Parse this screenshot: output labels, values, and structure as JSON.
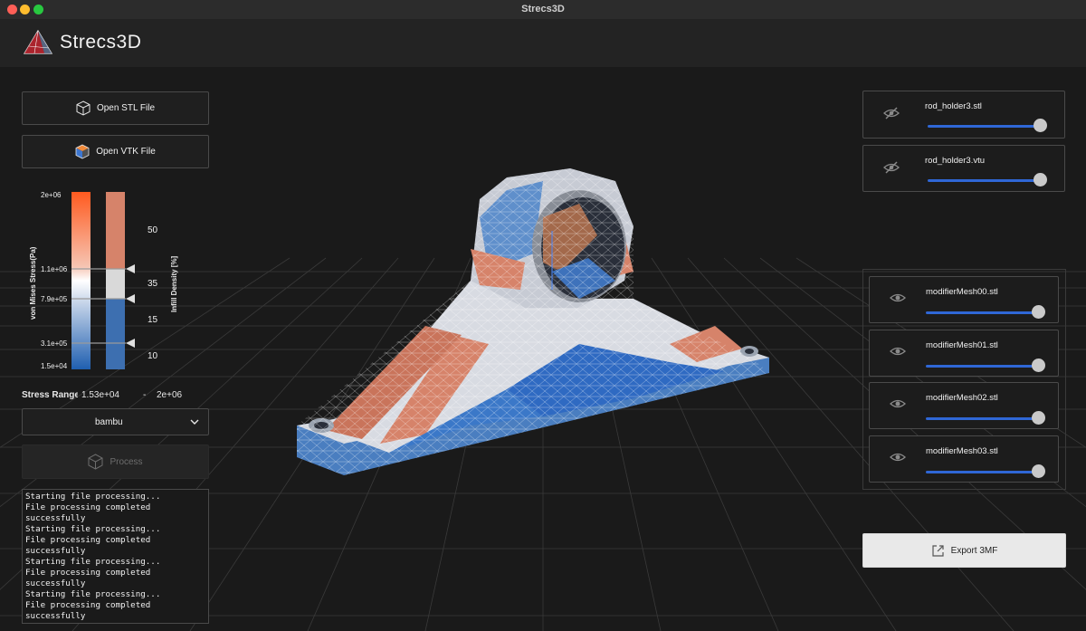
{
  "window": {
    "title": "Strecs3D"
  },
  "header": {
    "brand": "Strecs3D"
  },
  "left_panel": {
    "open_stl_label": "Open STL File",
    "open_vtk_label": "Open VTK File",
    "legend": {
      "stress_axis_label": "von Mises Stress(Pa)",
      "infill_axis_label": "Infill Density [%]",
      "stress_ticks": [
        "2e+06",
        "1.1e+06",
        "7.9e+05",
        "3.1e+05",
        "1.5e+04"
      ],
      "infill_ticks": [
        "50",
        "35",
        "15",
        "10"
      ]
    },
    "stress_range": {
      "label": "Stress Range",
      "min": "1.53e+04",
      "separator": "-",
      "max": "2e+06"
    },
    "preset_select": {
      "value": "bambu"
    },
    "process_label": "Process",
    "log_lines": [
      "Starting file processing...",
      "File processing completed",
      "successfully",
      "Starting file processing...",
      "File processing completed",
      "successfully",
      "Starting file processing...",
      "File processing completed",
      "successfully",
      "Starting file processing...",
      "File processing completed",
      "successfully"
    ]
  },
  "right_panel": {
    "files": [
      {
        "name": "rod_holder3.stl",
        "visible": false,
        "opacity": 1.0
      },
      {
        "name": "rod_holder3.vtu",
        "visible": false,
        "opacity": 1.0
      }
    ],
    "modifiers": [
      {
        "name": "modifierMesh00.stl",
        "visible": true,
        "opacity": 1.0
      },
      {
        "name": "modifierMesh01.stl",
        "visible": true,
        "opacity": 1.0
      },
      {
        "name": "modifierMesh02.stl",
        "visible": true,
        "opacity": 1.0
      },
      {
        "name": "modifierMesh03.stl",
        "visible": true,
        "opacity": 1.0
      }
    ],
    "export_label": "Export 3MF"
  },
  "colors": {
    "accent_blue": "#2f67d6",
    "stress_high": "#ff5a1f",
    "stress_low": "#1f5fb0",
    "infill_high": "#d6836a",
    "infill_low": "#3d6fb0"
  }
}
